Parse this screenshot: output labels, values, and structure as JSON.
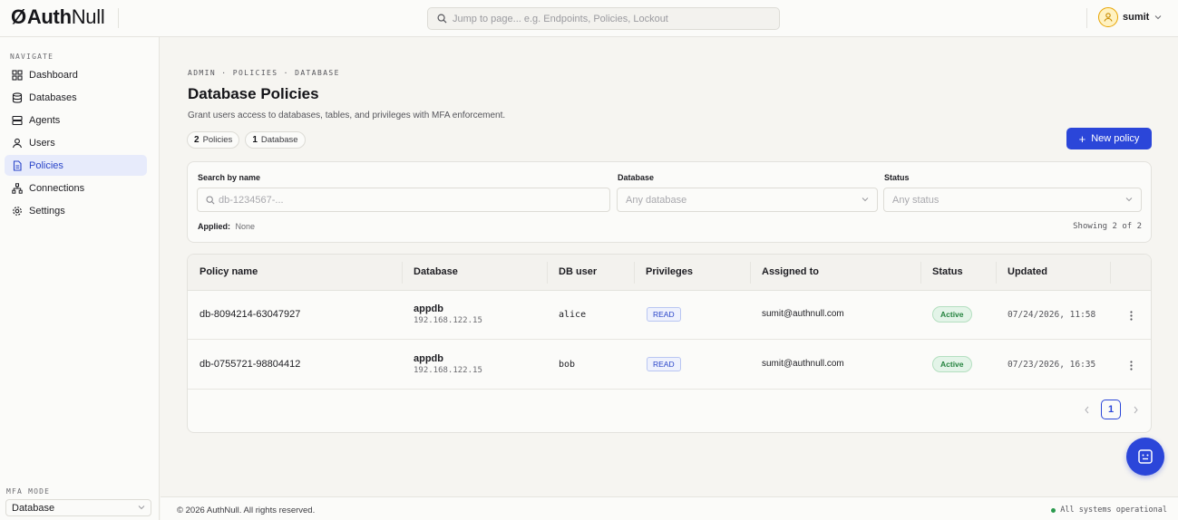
{
  "brand": {
    "symbol": "Ø",
    "name_bold": "Auth",
    "name_light": "Null"
  },
  "global_search": {
    "placeholder": "Jump to page... e.g. Endpoints, Policies, Lockout",
    "icon": "search-icon"
  },
  "user": {
    "name": "sumit",
    "icon": "user-icon"
  },
  "sidebar": {
    "heading": "NAVIGATE",
    "items": [
      {
        "label": "Dashboard",
        "icon": "grid-icon",
        "active": false
      },
      {
        "label": "Databases",
        "icon": "database-icon",
        "active": false
      },
      {
        "label": "Agents",
        "icon": "server-icon",
        "active": false
      },
      {
        "label": "Users",
        "icon": "user-icon",
        "active": false
      },
      {
        "label": "Policies",
        "icon": "file-icon",
        "active": true
      },
      {
        "label": "Connections",
        "icon": "network-icon",
        "active": false
      },
      {
        "label": "Settings",
        "icon": "gear-icon",
        "active": false
      }
    ],
    "mfa_label": "MFA MODE",
    "mfa_value": "Database"
  },
  "page": {
    "breadcrumb": "ADMIN · POLICIES · DATABASE",
    "title": "Database Policies",
    "subtitle": "Grant users access to databases, tables, and privileges with MFA enforcement.",
    "chips": [
      {
        "count": "2",
        "label": "Policies"
      },
      {
        "count": "1",
        "label": "Database"
      }
    ],
    "new_button": "New policy"
  },
  "filters": {
    "search_label": "Search by name",
    "search_placeholder": "db-1234567-...",
    "database_label": "Database",
    "database_placeholder": "Any database",
    "status_label": "Status",
    "status_placeholder": "Any status",
    "applied_label": "Applied:",
    "applied_value": "None",
    "showing": "Showing 2 of 2"
  },
  "table": {
    "columns": [
      "Policy name",
      "Database",
      "DB user",
      "Privileges",
      "Assigned to",
      "Status",
      "Updated"
    ],
    "rows": [
      {
        "name": "db-8094214-63047927",
        "db": "appdb",
        "ip": "192.168.122.15",
        "dbuser": "alice",
        "priv": "READ",
        "assigned": "sumit@authnull.com",
        "status": "Active",
        "updated": "07/24/2026, 11:58"
      },
      {
        "name": "db-0755721-98804412",
        "db": "appdb",
        "ip": "192.168.122.15",
        "dbuser": "bob",
        "priv": "READ",
        "assigned": "sumit@authnull.com",
        "status": "Active",
        "updated": "07/23/2026, 16:35"
      }
    ],
    "page": "1"
  },
  "footer": {
    "copyright": "© 2026 AuthNull. All rights reserved.",
    "status": "All systems operational"
  },
  "colors": {
    "accent": "#2b46d9",
    "active_bg": "#e7ebfb",
    "success": "#25833f",
    "background": "#f6f5f1"
  }
}
